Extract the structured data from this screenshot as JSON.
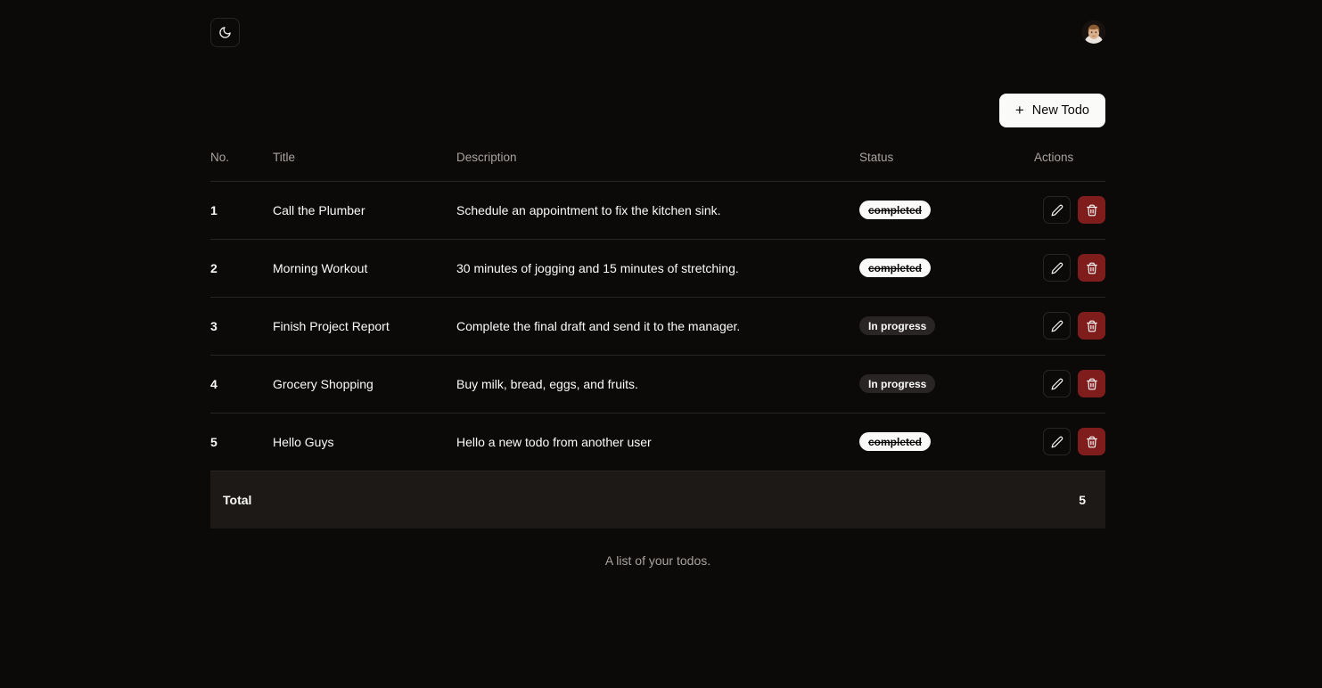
{
  "theme": {
    "toggle_icon": "moon-icon",
    "toggle_label": "Toggle dark mode"
  },
  "user": {
    "avatar_icon": "user-avatar-photo"
  },
  "toolbar": {
    "new_todo_label": "New Todo",
    "new_todo_plus": "+"
  },
  "table": {
    "columns": [
      "No.",
      "Title",
      "Description",
      "Status",
      "Actions"
    ],
    "caption": "A list of your todos.",
    "rows": [
      {
        "no": "1",
        "title": "Call the Plumber",
        "description": "Schedule an appointment to fix the kitchen sink.",
        "status": "completed",
        "status_kind": "completed"
      },
      {
        "no": "2",
        "title": "Morning Workout",
        "description": "30 minutes of jogging and 15 minutes of stretching.",
        "status": "completed",
        "status_kind": "completed"
      },
      {
        "no": "3",
        "title": "Finish Project Report",
        "description": "Complete the final draft and send it to the manager.",
        "status": "In progress",
        "status_kind": "inprogress"
      },
      {
        "no": "4",
        "title": "Grocery Shopping",
        "description": "Buy milk, bread, eggs, and fruits.",
        "status": "In progress",
        "status_kind": "inprogress"
      },
      {
        "no": "5",
        "title": "Hello Guys",
        "description": "Hello a new todo from another user",
        "status": "completed",
        "status_kind": "completed"
      }
    ],
    "footer": {
      "label": "Total",
      "count": "5"
    },
    "row_actions": {
      "edit_icon": "pencil-icon",
      "delete_icon": "trash-icon"
    }
  },
  "colors": {
    "background": "#0c0a09",
    "foreground": "#fafaf9",
    "muted": "#a8a29e",
    "border": "#292524",
    "footer_bg": "#1c1917",
    "badge_completed_bg": "#fafaf9",
    "badge_inprogress_bg": "#292524",
    "delete_bg": "#7f1d1d",
    "accent_button_bg": "#fafaf9"
  }
}
